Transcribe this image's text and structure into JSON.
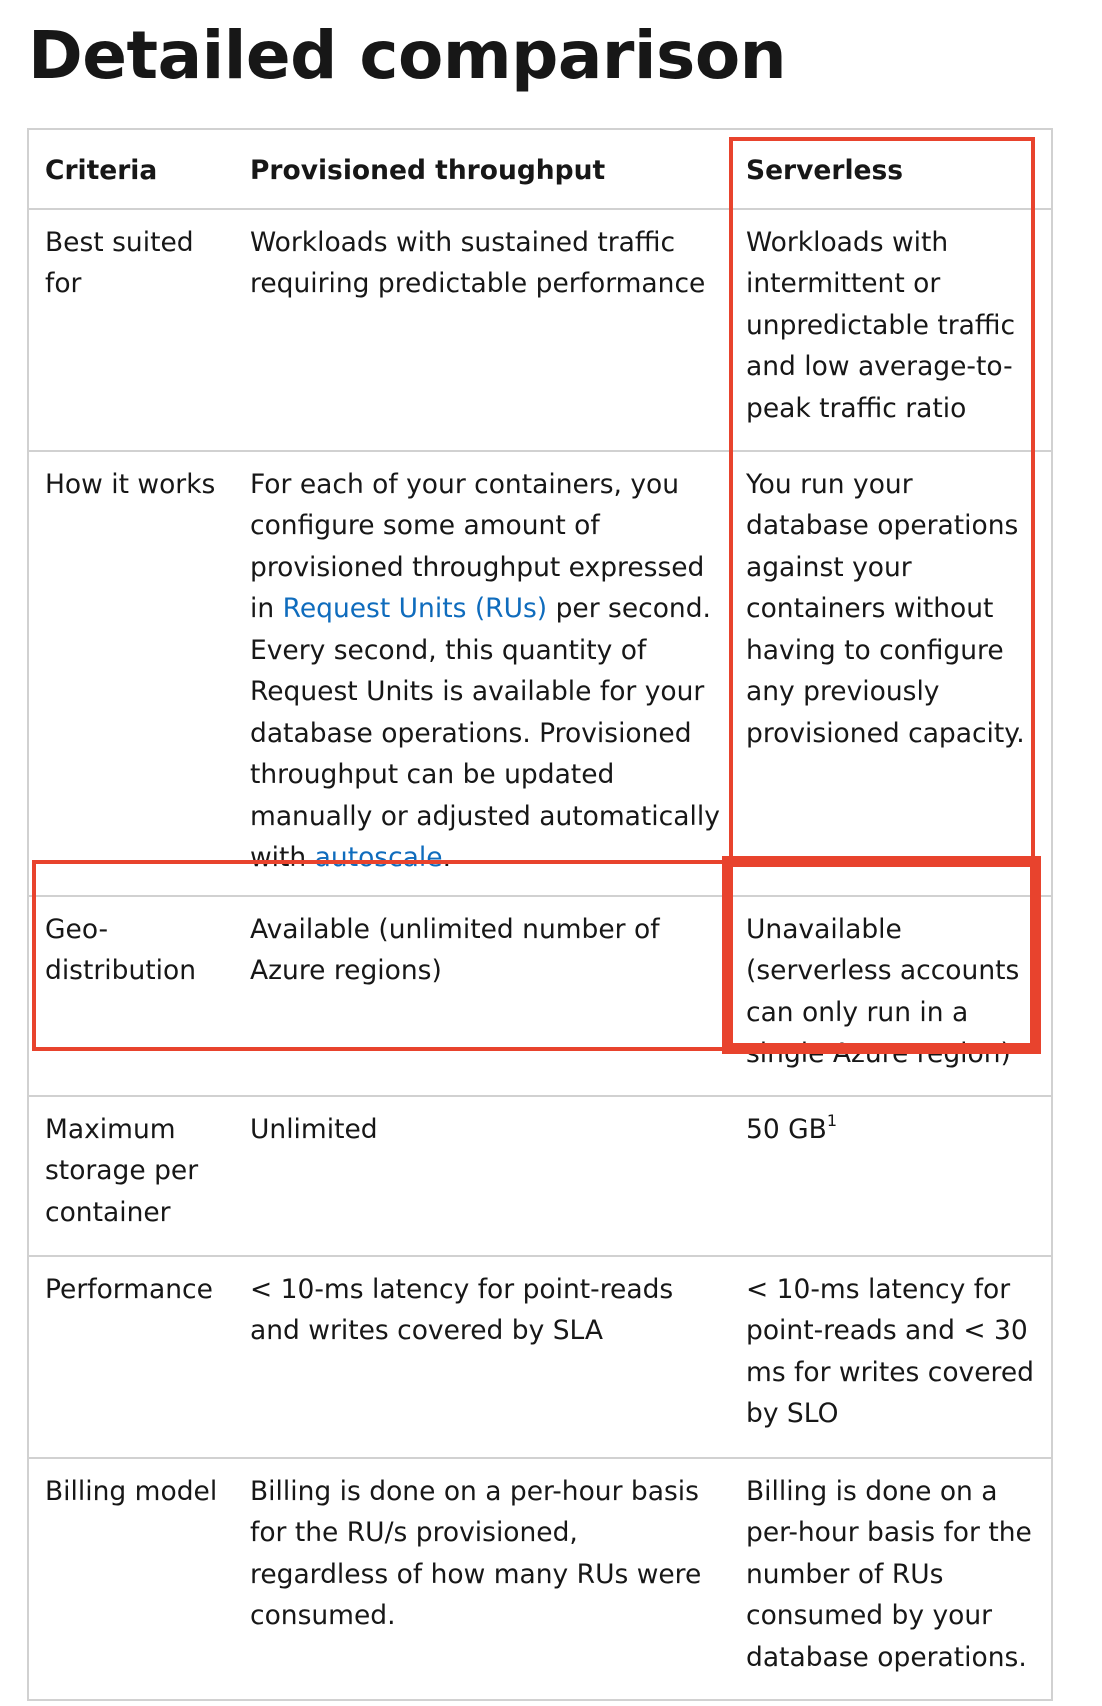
{
  "page": {
    "title": "Detailed comparison"
  },
  "highlight_color": "#e8432d",
  "link_color": "#0f6cbd",
  "table": {
    "headers": [
      "Criteria",
      "Provisioned throughput",
      "Serverless"
    ],
    "rows": [
      {
        "criteria": "Best suited for",
        "provisioned": "Workloads with sustained traffic requiring predictable performance",
        "serverless": "Workloads with intermittent or unpredictable traffic and low average-to-peak traffic ratio"
      },
      {
        "criteria": "How it works",
        "provisioned_parts": {
          "text1": "For each of your containers, you configure some amount of provisioned throughput expressed in ",
          "link1": "Request Units (RUs)",
          "text2": " per second. Every second, this quantity of Request Units is available for your database operations. Provisioned throughput can be updated manually or adjusted automatically with ",
          "link2": "autoscale",
          "text3": "."
        },
        "serverless": "You run your database operations against your containers without having to configure any previously provisioned capacity."
      },
      {
        "criteria": "Geo-distribution",
        "provisioned": "Available (unlimited number of Azure regions)",
        "serverless": "Unavailable (serverless accounts can only run in a single Azure region)"
      },
      {
        "criteria": "Maximum storage per container",
        "provisioned": "Unlimited",
        "serverless": "50 GB",
        "serverless_sup": "1"
      },
      {
        "criteria": "Performance",
        "provisioned": "< 10-ms latency for point-reads and writes covered by SLA",
        "serverless": "< 10-ms latency for point-reads and < 30 ms for writes covered by SLO"
      },
      {
        "criteria": "Billing model",
        "provisioned": "Billing is done on a per-hour basis for the RU/s provisioned, regardless of how many RUs were consumed.",
        "serverless": "Billing is done on a per-hour basis for the number of RUs consumed by your database operations."
      }
    ]
  }
}
